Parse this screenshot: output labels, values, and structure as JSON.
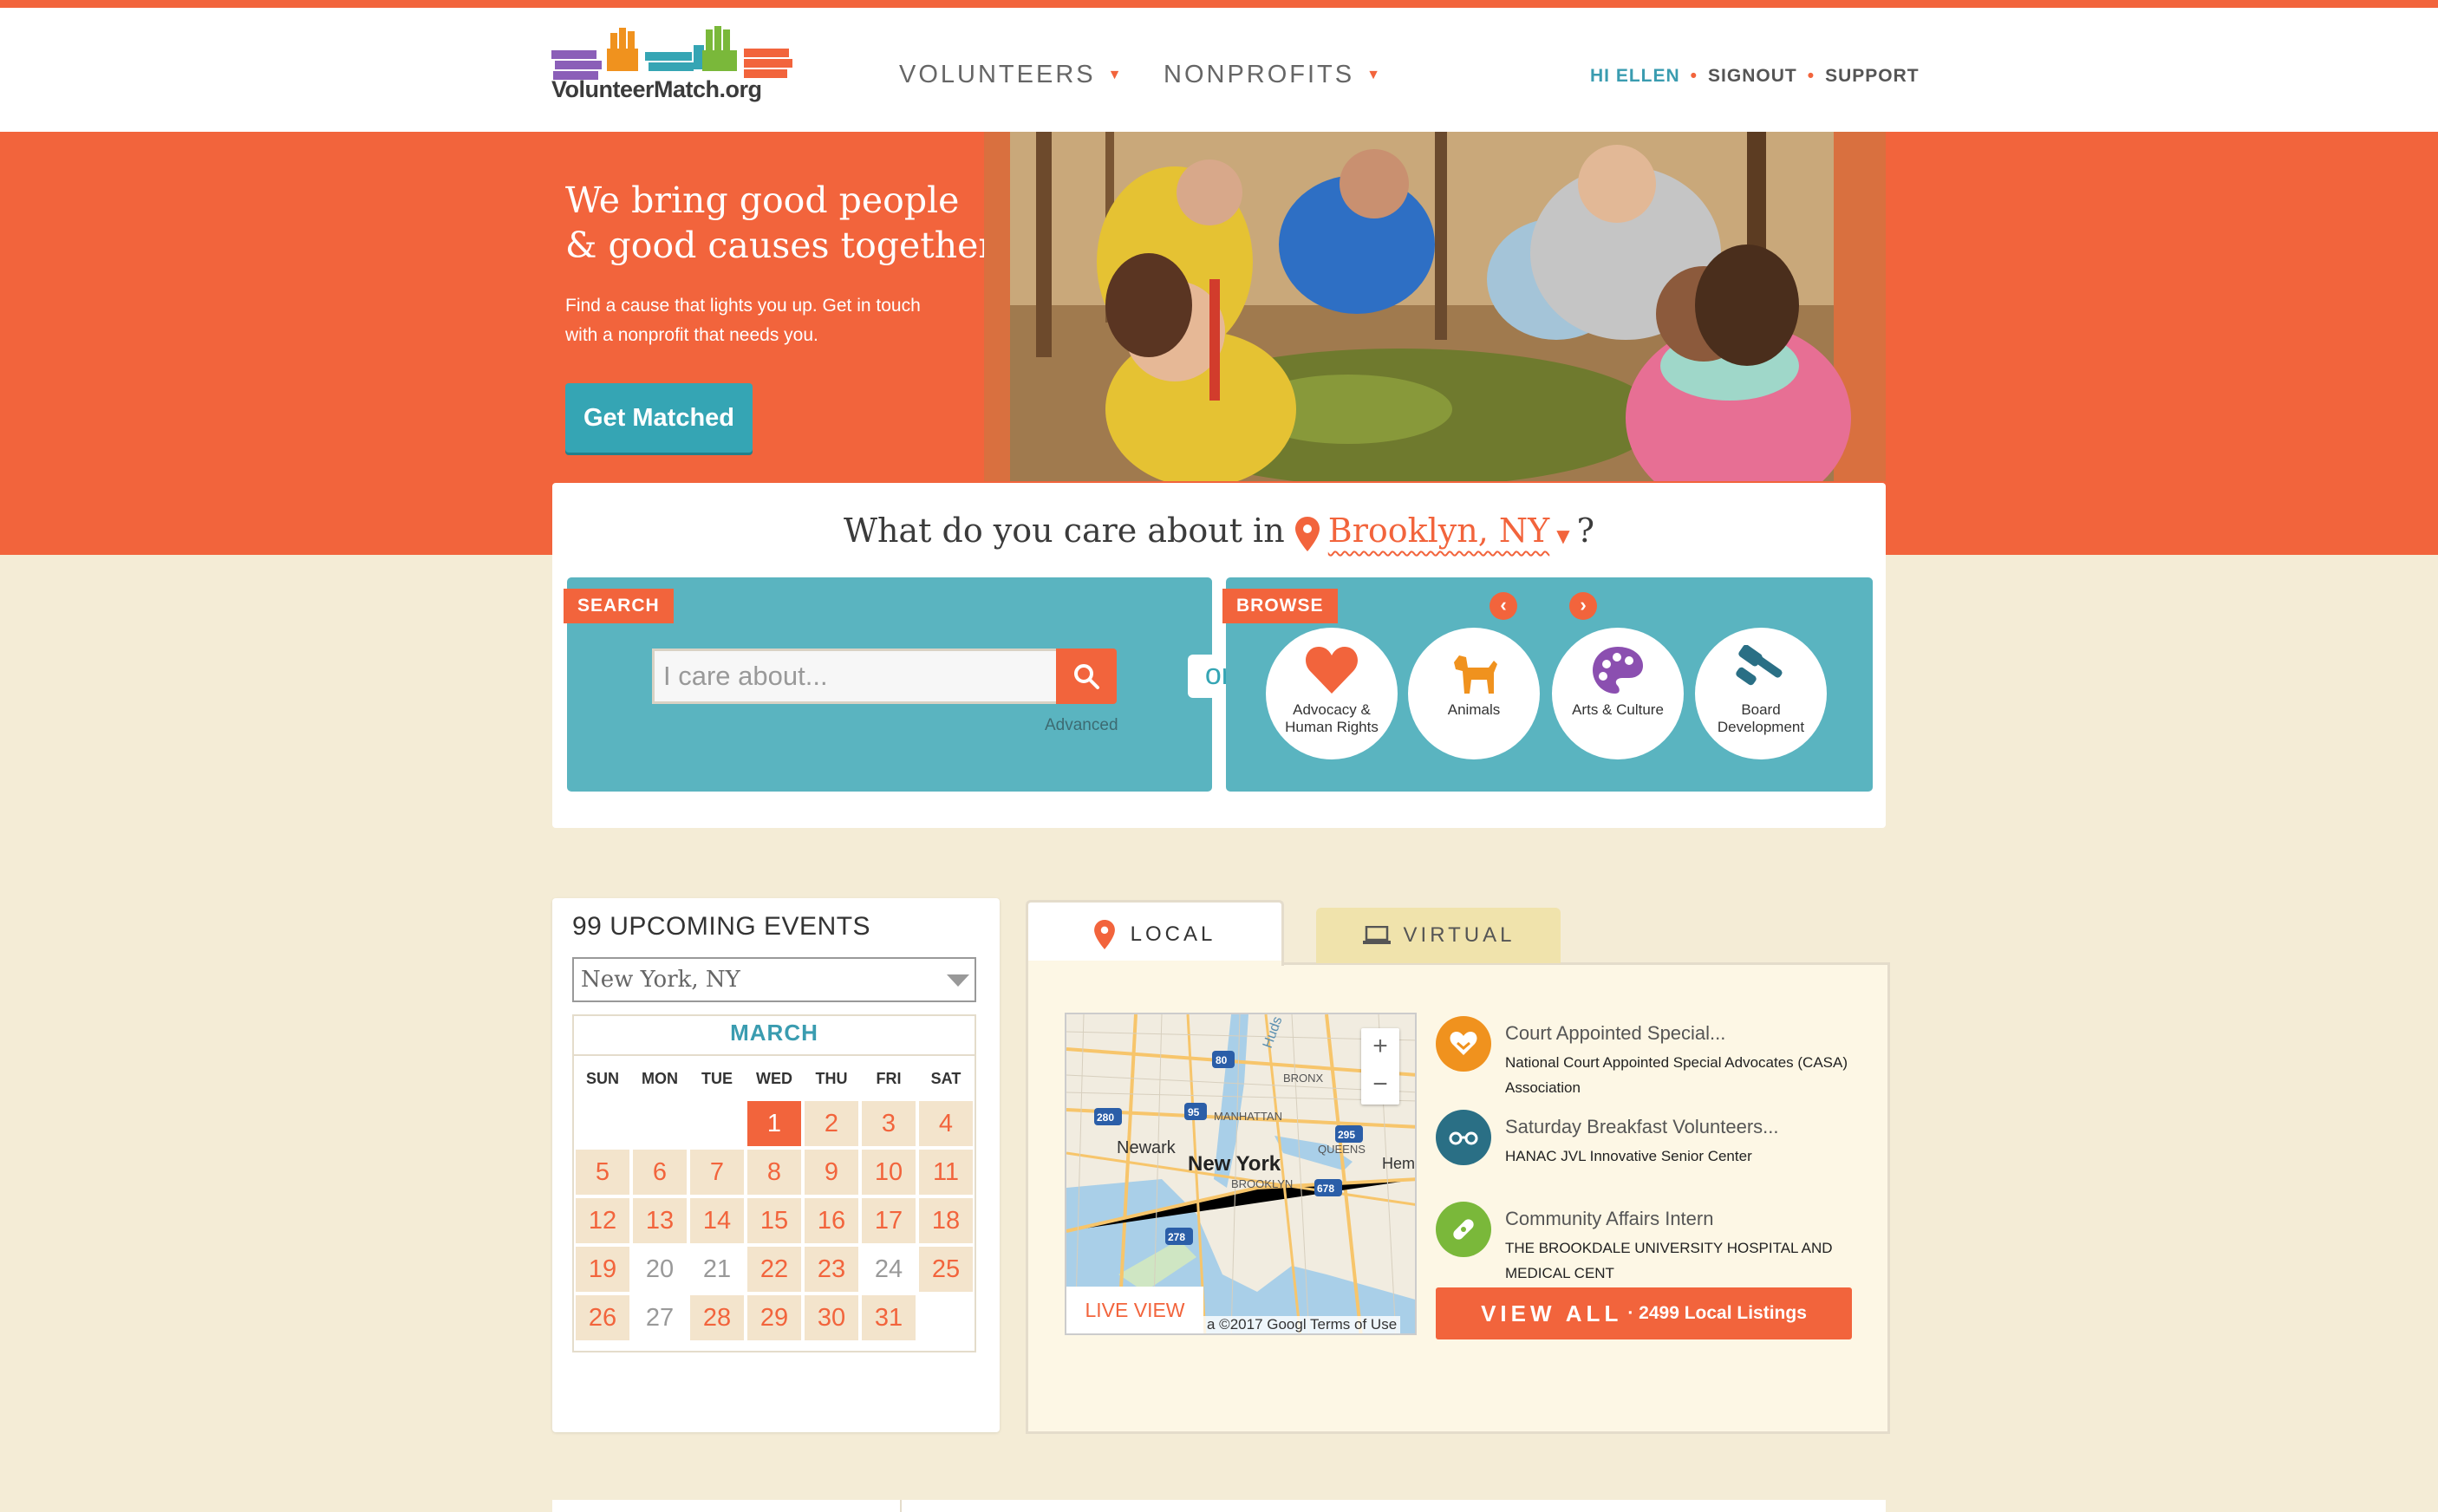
{
  "brand": {
    "logo_text": "VolunteerMatch.org",
    "accent": "#f2643c",
    "teal": "#35a5b4",
    "cream": "#f4ecd6"
  },
  "nav": {
    "volunteers": "VOLUNTEERS",
    "nonprofits": "NONPROFITS",
    "caret_icon": "caret-down-icon"
  },
  "user_nav": {
    "greeting": "HI ELLEN",
    "signout": "SIGNOUT",
    "support": "SUPPORT",
    "separator": "•"
  },
  "hero": {
    "title_line1": "We bring good people",
    "title_line2": "& good causes together",
    "subtitle": "Find a cause that lights you up. Get in touch with a nonprofit that needs you.",
    "cta": "Get Matched"
  },
  "care": {
    "prefix": "What do you care about in",
    "location": "Brooklyn, NY",
    "suffix": "?"
  },
  "search": {
    "tag": "SEARCH",
    "placeholder": "I care about...",
    "advanced": "Advanced",
    "or": "or"
  },
  "browse": {
    "tag": "BROWSE",
    "categories": [
      {
        "label_l1": "Advocacy &",
        "label_l2": "Human Rights",
        "icon": "heart-icon",
        "color": "#f2643c"
      },
      {
        "label_l1": "Animals",
        "label_l2": "",
        "icon": "dog-icon",
        "color": "#f0921e"
      },
      {
        "label_l1": "Arts & Culture",
        "label_l2": "",
        "icon": "palette-icon",
        "color": "#8b4fb0"
      },
      {
        "label_l1": "Board",
        "label_l2": "Development",
        "icon": "gavel-icon",
        "color": "#2a6f85"
      }
    ]
  },
  "events": {
    "title": "99 UPCOMING EVENTS",
    "location_select": "New York, NY",
    "month": "MARCH",
    "dow": [
      "SUN",
      "MON",
      "TUE",
      "WED",
      "THU",
      "FRI",
      "SAT"
    ],
    "weeks": [
      [
        "",
        "",
        "",
        "1",
        "2",
        "3",
        "4"
      ],
      [
        "5",
        "6",
        "7",
        "8",
        "9",
        "10",
        "11"
      ],
      [
        "12",
        "13",
        "14",
        "15",
        "16",
        "17",
        "18"
      ],
      [
        "19",
        "20",
        "21",
        "22",
        "23",
        "24",
        "25"
      ],
      [
        "26",
        "27",
        "28",
        "29",
        "30",
        "31",
        ""
      ]
    ],
    "today": "1",
    "muted_days": [
      "20",
      "21",
      "24",
      "27"
    ]
  },
  "listings_tabs": {
    "local": "LOCAL",
    "virtual": "VIRTUAL"
  },
  "map": {
    "live_view": "LIVE VIEW",
    "copyright": "a ©2017 Googl Terms of Use",
    "zoom_in": "+",
    "zoom_out": "−",
    "labels": {
      "bronx": "BRONX",
      "manhattan": "MANHATTAN",
      "newark": "Newark",
      "new_york": "New York",
      "queens": "QUEENS",
      "brooklyn": "BROOKLYN",
      "hem": "Hem",
      "huds": "Huds"
    },
    "shields": [
      "80",
      "95",
      "280",
      "295",
      "678",
      "278"
    ]
  },
  "listings": [
    {
      "title": "Court Appointed Special...",
      "org": "National Court Appointed Special Advocates (CASA) Association",
      "icon": "handshake-heart-icon",
      "color": "#f0921e"
    },
    {
      "title": "Saturday Breakfast Volunteers...",
      "org": "HANAC JVL Innovative Senior Center",
      "icon": "glasses-icon",
      "color": "#2a6f85"
    },
    {
      "title": "Community Affairs Intern",
      "org": "THE BROOKDALE UNIVERSITY HOSPITAL AND MEDICAL CENT",
      "icon": "bandage-icon",
      "color": "#7ab83a"
    }
  ],
  "view_all": {
    "label": "VIEW ALL",
    "count": "· 2499 Local Listings"
  }
}
